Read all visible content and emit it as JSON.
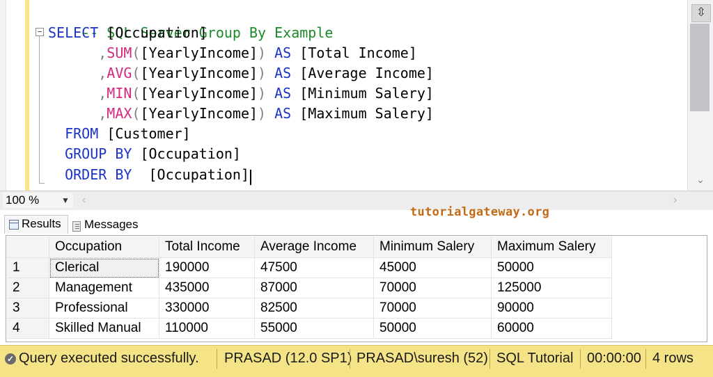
{
  "editor": {
    "comment": "-- SQL Server Group By Example",
    "collapse_glyph": "−",
    "lines": {
      "select_kw": "SELECT",
      "occupation": "[Occupation]",
      "comma": ",",
      "sum_fn": "SUM",
      "avg_fn": "AVG",
      "min_fn": "MIN",
      "max_fn": "MAX",
      "open_paren": "(",
      "close_paren": ")",
      "yearly_income": "[YearlyIncome]",
      "as_kw": "AS",
      "total_income": "[Total Income]",
      "average_income": "[Average Income]",
      "minimum_salery": "[Minimum Salery]",
      "maximum_salery": "[Maximum Salery]",
      "from_kw": "FROM",
      "customer": "[Customer]",
      "group_by_kw": "GROUP BY",
      "order_by_kw": "ORDER BY",
      "order_occupation": " [Occupation]"
    }
  },
  "zoom": {
    "value": "100 %",
    "arrow": "▼"
  },
  "watermark": "tutorialgateway.org",
  "tabs": [
    {
      "label": "Results"
    },
    {
      "label": "Messages"
    }
  ],
  "grid": {
    "columns": [
      "Occupation",
      "Total Income",
      "Average Income",
      "Minimum Salery",
      "Maximum Salery"
    ],
    "rows": [
      [
        "1",
        "Clerical",
        "190000",
        "47500",
        "45000",
        "50000"
      ],
      [
        "2",
        "Management",
        "435000",
        "87000",
        "70000",
        "125000"
      ],
      [
        "3",
        "Professional",
        "330000",
        "82500",
        "70000",
        "90000"
      ],
      [
        "4",
        "Skilled Manual",
        "110000",
        "55000",
        "50000",
        "60000"
      ]
    ]
  },
  "status": {
    "message": "Query executed successfully.",
    "server": "PRASAD (12.0 SP1)",
    "user": "PRASAD\\suresh (52)",
    "database": "SQL Tutorial",
    "elapsed": "00:00:00",
    "rows": "4 rows"
  },
  "colors": {
    "keyword": "#1a33c9",
    "function": "#d5287f",
    "comment": "#1b8a2a",
    "status_bar": "#f4e487",
    "watermark": "#c46a14"
  }
}
